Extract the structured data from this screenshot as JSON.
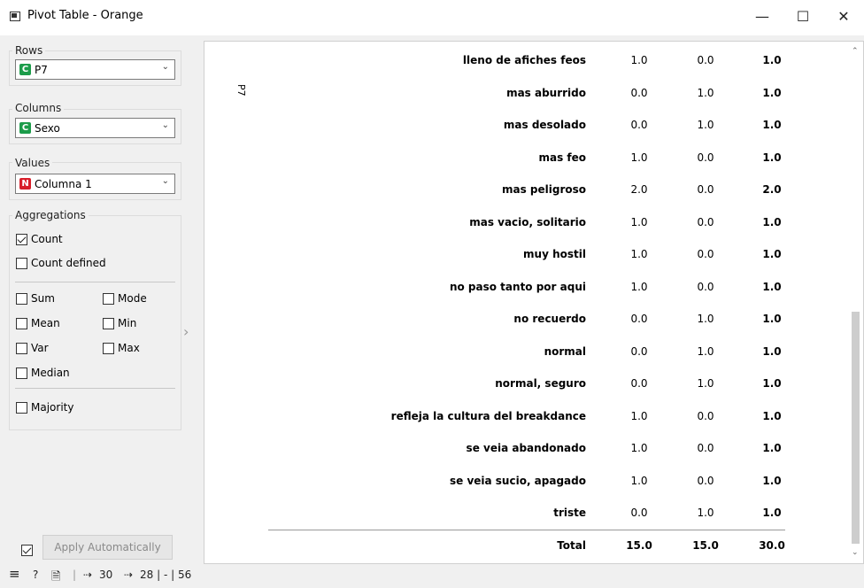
{
  "window": {
    "title": "Pivot Table - Orange",
    "minimize": "—",
    "maximize": "☐",
    "close": "✕"
  },
  "sidebar": {
    "rows": {
      "label": "Rows",
      "type_badge": "C",
      "value": "P7",
      "badge_color": "#1c9c4a"
    },
    "columns": {
      "label": "Columns",
      "type_badge": "C",
      "value": "Sexo",
      "badge_color": "#1c9c4a"
    },
    "values": {
      "label": "Values",
      "type_badge": "N",
      "value": "Columna 1",
      "badge_color": "#d81e2a"
    },
    "aggregations": {
      "label": "Aggregations",
      "count": {
        "label": "Count",
        "checked": true
      },
      "count_defined": {
        "label": "Count defined",
        "checked": false
      },
      "sum": {
        "label": "Sum",
        "checked": false
      },
      "mode": {
        "label": "Mode",
        "checked": false
      },
      "mean": {
        "label": "Mean",
        "checked": false
      },
      "min": {
        "label": "Min",
        "checked": false
      },
      "var": {
        "label": "Var",
        "checked": false
      },
      "max": {
        "label": "Max",
        "checked": false
      },
      "median": {
        "label": "Median",
        "checked": false
      },
      "majority": {
        "label": "Majority",
        "checked": false
      }
    },
    "apply_automatically": {
      "label": "Apply Automatically",
      "checked": true
    }
  },
  "pivot": {
    "row_variable": "P7",
    "rows": [
      {
        "label": "lleno de afiches feos",
        "v1": "1.0",
        "v2": "0.0",
        "total": "1.0"
      },
      {
        "label": "mas aburrido",
        "v1": "0.0",
        "v2": "1.0",
        "total": "1.0"
      },
      {
        "label": "mas desolado",
        "v1": "0.0",
        "v2": "1.0",
        "total": "1.0"
      },
      {
        "label": "mas feo",
        "v1": "1.0",
        "v2": "0.0",
        "total": "1.0"
      },
      {
        "label": "mas peligroso",
        "v1": "2.0",
        "v2": "0.0",
        "total": "2.0"
      },
      {
        "label": "mas vacio, solitario",
        "v1": "1.0",
        "v2": "0.0",
        "total": "1.0"
      },
      {
        "label": "muy hostil",
        "v1": "1.0",
        "v2": "0.0",
        "total": "1.0"
      },
      {
        "label": "no paso tanto por aqui",
        "v1": "1.0",
        "v2": "0.0",
        "total": "1.0"
      },
      {
        "label": "no recuerdo",
        "v1": "0.0",
        "v2": "1.0",
        "total": "1.0"
      },
      {
        "label": "normal",
        "v1": "0.0",
        "v2": "1.0",
        "total": "1.0"
      },
      {
        "label": "normal, seguro",
        "v1": "0.0",
        "v2": "1.0",
        "total": "1.0"
      },
      {
        "label": "refleja la cultura del breakdance",
        "v1": "1.0",
        "v2": "0.0",
        "total": "1.0"
      },
      {
        "label": "se veia abandonado",
        "v1": "1.0",
        "v2": "0.0",
        "total": "1.0"
      },
      {
        "label": "se veia sucio, apagado",
        "v1": "1.0",
        "v2": "0.0",
        "total": "1.0"
      },
      {
        "label": "triste",
        "v1": "0.0",
        "v2": "1.0",
        "total": "1.0"
      }
    ],
    "total_row": {
      "label": "Total",
      "v1": "15.0",
      "v2": "15.0",
      "total": "30.0"
    }
  },
  "status": {
    "menu_icon": "≡",
    "help_icon": "?",
    "report_icon": "🗎",
    "input_count": "30",
    "output_text": "28 | - | 56"
  }
}
